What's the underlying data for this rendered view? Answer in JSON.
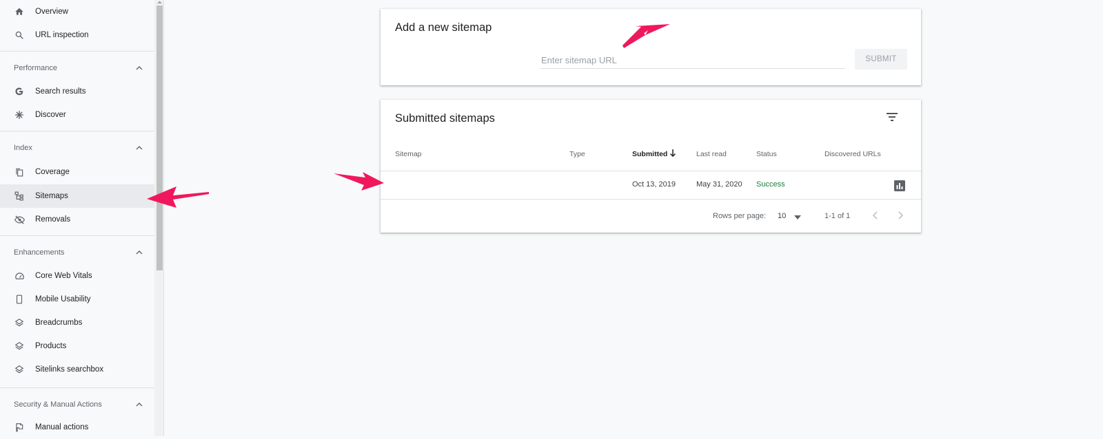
{
  "sidebar": {
    "top_items": [
      {
        "label": "Overview",
        "icon": "home-icon"
      },
      {
        "label": "URL inspection",
        "icon": "search-icon"
      }
    ],
    "sections": [
      {
        "title": "Performance",
        "items": [
          {
            "label": "Search results",
            "icon": "google-g-icon"
          },
          {
            "label": "Discover",
            "icon": "asterisk-icon"
          }
        ]
      },
      {
        "title": "Index",
        "items": [
          {
            "label": "Coverage",
            "icon": "copy-icon"
          },
          {
            "label": "Sitemaps",
            "icon": "sitemap-icon",
            "active": true
          },
          {
            "label": "Removals",
            "icon": "eye-off-icon"
          }
        ]
      },
      {
        "title": "Enhancements",
        "items": [
          {
            "label": "Core Web Vitals",
            "icon": "gauge-icon"
          },
          {
            "label": "Mobile Usability",
            "icon": "phone-icon"
          },
          {
            "label": "Breadcrumbs",
            "icon": "layers-icon"
          },
          {
            "label": "Products",
            "icon": "layers-icon"
          },
          {
            "label": "Sitelinks searchbox",
            "icon": "layers-icon"
          }
        ]
      },
      {
        "title": "Security & Manual Actions",
        "items": [
          {
            "label": "Manual actions",
            "icon": "flag-icon"
          }
        ]
      }
    ]
  },
  "add_sitemap": {
    "title": "Add a new sitemap",
    "placeholder": "Enter sitemap URL",
    "submit_label": "SUBMIT"
  },
  "submitted": {
    "title": "Submitted sitemaps",
    "columns": [
      "Sitemap",
      "Type",
      "Submitted",
      "Last read",
      "Status",
      "Discovered URLs"
    ],
    "rows": [
      {
        "sitemap": "",
        "type": "",
        "submitted": "Oct 13, 2019",
        "last_read": "May 31, 2020",
        "status": "Success",
        "discovered_urls": ""
      }
    ],
    "rows_per_page_label": "Rows per page:",
    "rows_per_page_value": "10",
    "range": "1-1 of 1"
  },
  "colors": {
    "accent_arrow": "#f0185c",
    "success": "#188038",
    "active_nav_bg": "#e8eaed"
  }
}
